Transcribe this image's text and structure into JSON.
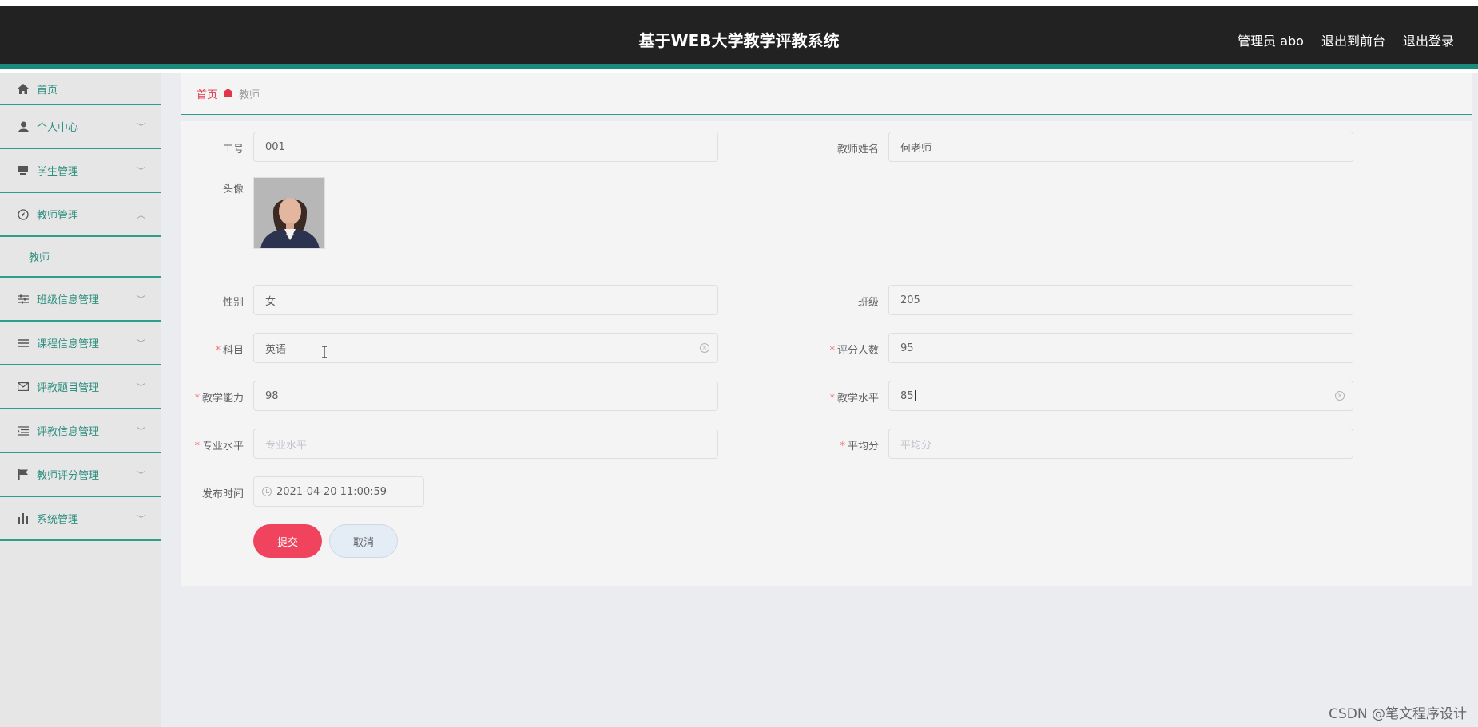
{
  "header": {
    "title": "基于WEB大学教学评教系统",
    "admin": "管理员 abo",
    "front": "退出到前台",
    "logout": "退出登录"
  },
  "sidebar": {
    "items": [
      {
        "label": "首页",
        "icon": "home-icon"
      },
      {
        "label": "个人中心",
        "icon": "user-icon"
      },
      {
        "label": "学生管理",
        "icon": "monitor-icon"
      },
      {
        "label": "教师管理",
        "icon": "compass-icon",
        "expanded": true,
        "sub": "教师"
      },
      {
        "label": "班级信息管理",
        "icon": "sliders-icon"
      },
      {
        "label": "课程信息管理",
        "icon": "list-icon"
      },
      {
        "label": "评教题目管理",
        "icon": "mail-icon"
      },
      {
        "label": "评教信息管理",
        "icon": "indent-icon"
      },
      {
        "label": "教师评分管理",
        "icon": "flag-icon"
      },
      {
        "label": "系统管理",
        "icon": "bar-chart-icon"
      }
    ]
  },
  "breadcrumb": {
    "home": "首页",
    "current": "教师"
  },
  "form": {
    "gonghao": {
      "label": "工号",
      "value": "001"
    },
    "name": {
      "label": "教师姓名",
      "value": "何老师"
    },
    "avatar": {
      "label": "头像"
    },
    "gender": {
      "label": "性别",
      "value": "女"
    },
    "banji": {
      "label": "班级",
      "value": "205"
    },
    "kemu": {
      "label": "科目",
      "value": "英语"
    },
    "pingfen": {
      "label": "评分人数",
      "value": "95"
    },
    "nengli": {
      "label": "教学能力",
      "value": "98"
    },
    "shuiping": {
      "label": "教学水平",
      "value": "85"
    },
    "zhuanye": {
      "label": "专业水平",
      "placeholder": "专业水平"
    },
    "avg": {
      "label": "平均分",
      "placeholder": "平均分"
    },
    "time": {
      "label": "发布时间",
      "value": "2021-04-20 11:00:59"
    },
    "submit": "提交",
    "cancel": "取消"
  },
  "watermark": "CSDN @笔文程序设计",
  "colors": {
    "accent": "#2e9d8a",
    "danger": "#f0445e",
    "header": "#222222"
  }
}
